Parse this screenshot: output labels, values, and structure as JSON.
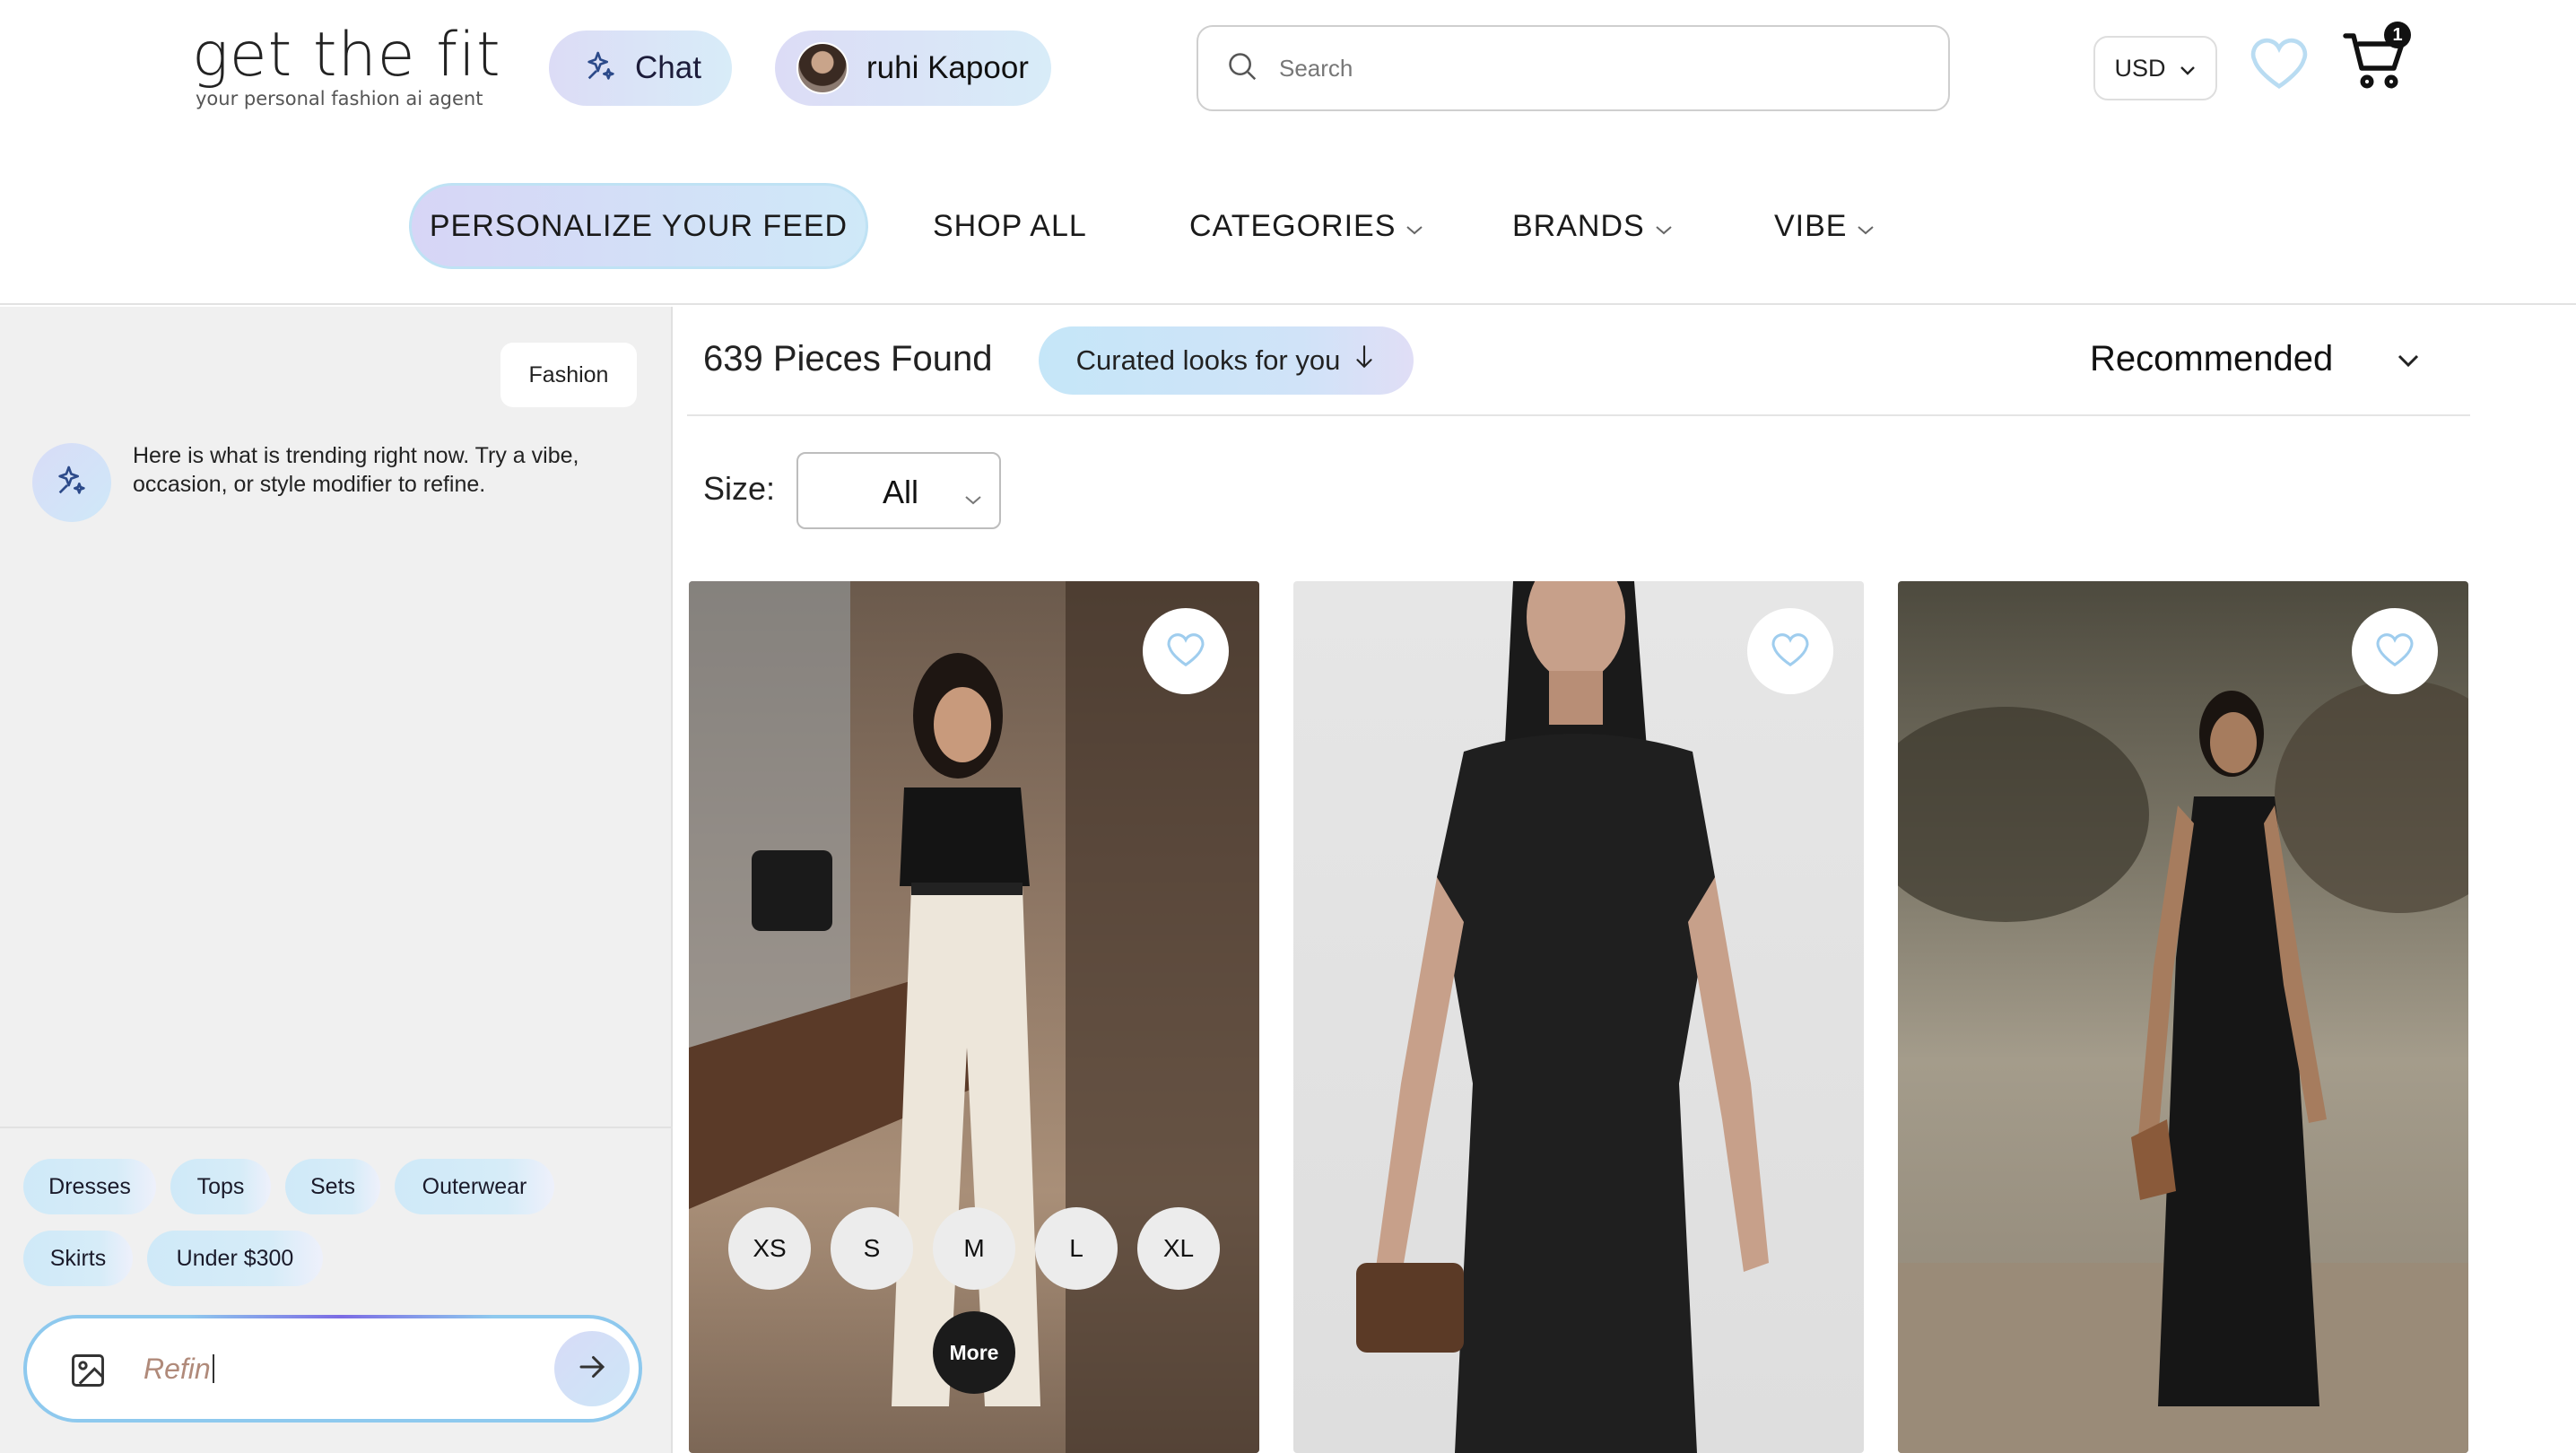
{
  "brand": {
    "name": "get the fit",
    "tagline": "your personal fashion ai agent"
  },
  "header": {
    "chat_label": "Chat",
    "user_name": "ruhi Kapoor",
    "search_placeholder": "Search",
    "currency": "USD",
    "cart_count": "1"
  },
  "nav": {
    "personalize": "PERSONALIZE YOUR FEED",
    "shop_all": "SHOP ALL",
    "categories": "CATEGORIES",
    "brands": "BRANDS",
    "vibe": "VIBE"
  },
  "chat": {
    "user_message": "Fashion",
    "bot_message": "Here is what is trending right now. Try a vibe, occasion, or style modifier to refine.",
    "chips": [
      "Dresses",
      "Tops",
      "Sets",
      "Outerwear",
      "Skirts",
      "Under $300"
    ],
    "input_value": "Refin"
  },
  "results": {
    "count_text": "639 Pieces Found",
    "curated_label": "Curated looks for you",
    "sort_label": "Recommended",
    "size_label": "Size:",
    "size_value": "All"
  },
  "products": [
    {
      "image": "woman in black polo and white wide-leg trousers in office",
      "sizes": [
        "XS",
        "S",
        "M",
        "L",
        "XL"
      ],
      "more_label": "More"
    },
    {
      "image": "black sleeveless ruched midi dress with brown handbag"
    },
    {
      "image": "black knit maxi dress on rocky beach"
    }
  ],
  "colors": {
    "accent_blue": "#cfe9f8",
    "accent_lavender": "#d7d5f6",
    "panel_bg": "#f0f0f0"
  }
}
